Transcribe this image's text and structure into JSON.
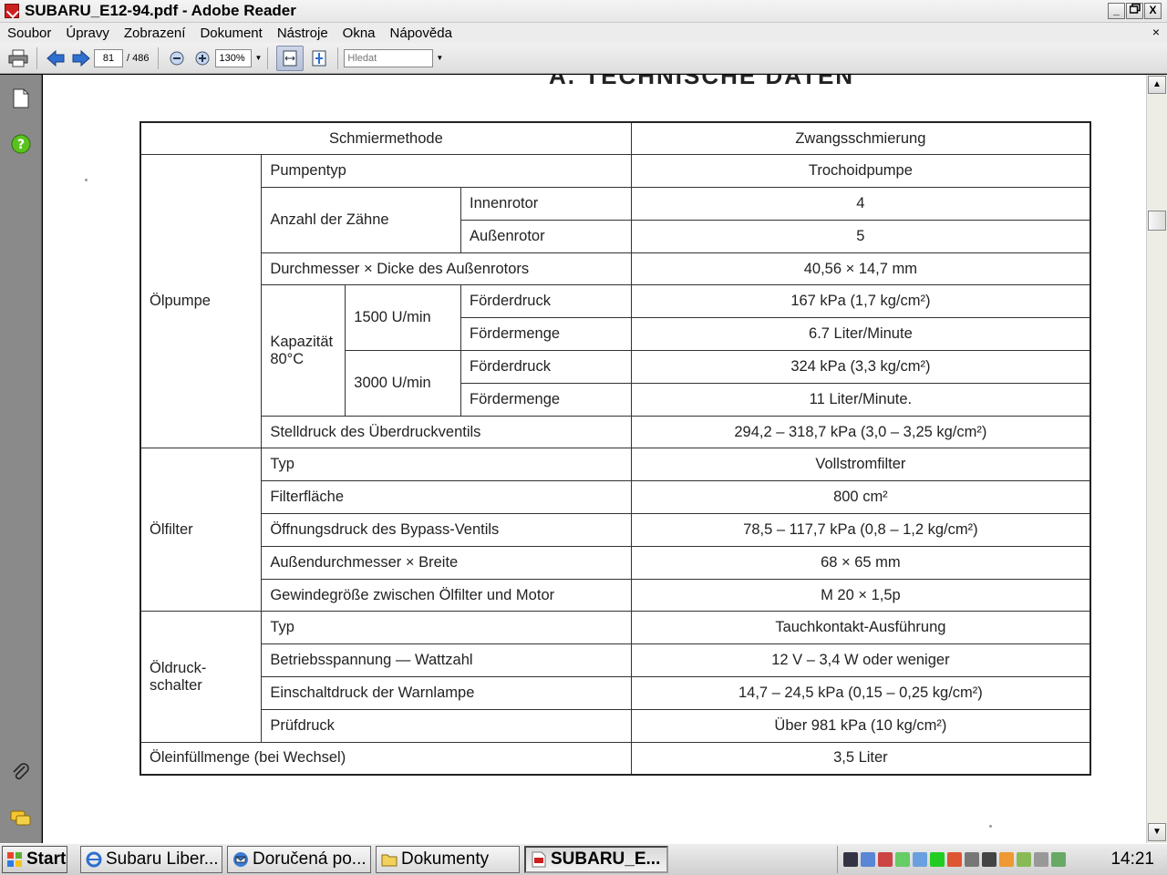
{
  "window": {
    "title": "SUBARU_E12-94.pdf - Adobe Reader",
    "min": "_",
    "restore": "🗗",
    "close": "X"
  },
  "menubar": {
    "items": [
      "Soubor",
      "Úpravy",
      "Zobrazení",
      "Dokument",
      "Nástroje",
      "Okna",
      "Nápověda"
    ],
    "close_doc": "×"
  },
  "toolbar": {
    "page_current": "81",
    "page_total": "/ 486",
    "zoom": "130%",
    "search_placeholder": "Hledat"
  },
  "document": {
    "heading_fragment": "A. TECHNISCHE DATEN",
    "table": {
      "schmiermethode_label": "Schmiermethode",
      "schmiermethode_value": "Zwangsschmierung",
      "oelpumpe": "Ölpumpe",
      "pumpentyp_label": "Pumpentyp",
      "pumpentyp_value": "Trochoidpumpe",
      "zaehne_label": "Anzahl der Zähne",
      "innenrotor_label": "Innenrotor",
      "innenrotor_value": "4",
      "aussenrotor_label": "Außenrotor",
      "aussenrotor_value": "5",
      "durchmesser_label": "Durchmesser × Dicke des Außenrotors",
      "durchmesser_value": "40,56 × 14,7 mm",
      "kapazitaet_label": "Kapazität 80°C",
      "rpm1": "1500 U/min",
      "rpm2": "3000 U/min",
      "foerderdruck": "Förderdruck",
      "foerdermenge": "Fördermenge",
      "fd1_value": "167 kPa (1,7 kg/cm²)",
      "fm1_value": "6.7 Liter/Minute",
      "fd2_value": "324 kPa (3,3 kg/cm²)",
      "fm2_value": "11 Liter/Minute.",
      "stelldruck_label": "Stelldruck des Überdruckventils",
      "stelldruck_value": "294,2 – 318,7 kPa (3,0 – 3,25 kg/cm²)",
      "oelfilter": "Ölfilter",
      "typ_label": "Typ",
      "filter_typ_value": "Vollstromfilter",
      "filterflaeche_label": "Filterfläche",
      "filterflaeche_value": "800 cm²",
      "oeffnungsdruck_label": "Öffnungsdruck des Bypass-Ventils",
      "oeffnungsdruck_value": "78,5 – 117,7 kPa (0,8 – 1,2 kg/cm²)",
      "aussendurchmesser_label": "Außendurchmesser × Breite",
      "aussendurchmesser_value": "68 × 65 mm",
      "gewinde_label": "Gewindegröße zwischen Ölfilter und Motor",
      "gewinde_value": "M 20 × 1,5p",
      "oeldruckschalter": "Öldruck-schalter",
      "schalter_typ_value": "Tauchkontakt-Ausführung",
      "betriebsspannung_label": "Betriebsspannung — Wattzahl",
      "betriebsspannung_value": "12 V – 3,4 W oder weniger",
      "einschaltdruck_label": "Einschaltdruck der Warnlampe",
      "einschaltdruck_value": "14,7 – 24,5 kPa (0,15 – 0,25 kg/cm²)",
      "pruefdruck_label": "Prüfdruck",
      "pruefdruck_value": "Über 981 kPa (10 kg/cm²)",
      "einfuellmenge_label": "Öleinfüllmenge (bei Wechsel)",
      "einfuellmenge_value": "3,5 Liter"
    }
  },
  "taskbar": {
    "start": "Start",
    "tasks": [
      "Subaru Liber...",
      "Doručená po...",
      "Dokumenty",
      "SUBARU_E..."
    ],
    "clock": "14:21"
  }
}
